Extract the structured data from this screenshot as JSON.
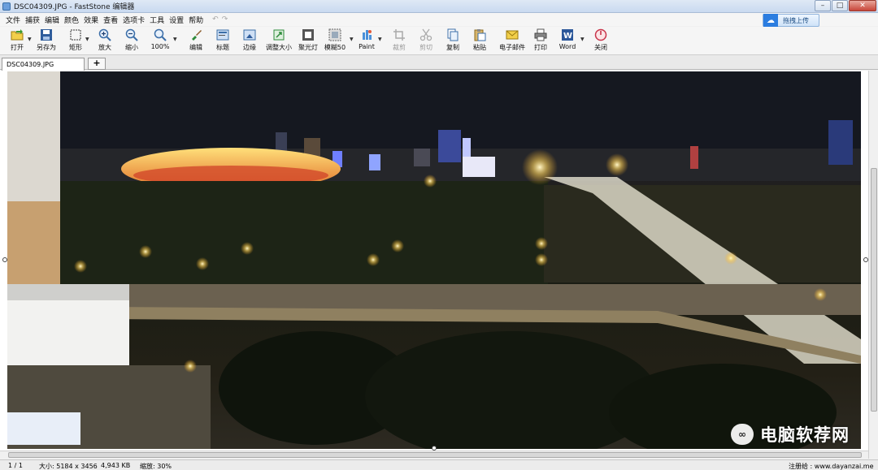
{
  "window": {
    "title": "DSC04309.JPG - FastStone 编辑器",
    "minimize": "–",
    "maximize": "□",
    "close": "✕"
  },
  "menu": [
    "文件",
    "捕获",
    "编辑",
    "颜色",
    "效果",
    "查看",
    "选项卡",
    "工具",
    "设置",
    "帮助"
  ],
  "menu_undo": "↶",
  "menu_redo": "↷",
  "upload": {
    "label": "拖拽上传",
    "icon": "cloud-icon"
  },
  "toolbar": {
    "open": {
      "label": "打开",
      "icon": "open-folder-icon",
      "color": "#3c9a2a"
    },
    "save_as": {
      "label": "另存为",
      "icon": "floppy-disk-icon",
      "color": "#2f5d9c"
    },
    "rect": {
      "label": "矩形",
      "icon": "rectangle-select-icon"
    },
    "zoom_in": {
      "label": "放大",
      "icon": "zoom-in-icon"
    },
    "zoom_out": {
      "label": "缩小",
      "icon": "zoom-out-icon"
    },
    "zoom_100": {
      "label": "100%",
      "icon": "magnifier-icon"
    },
    "edit": {
      "label": "编辑",
      "icon": "paint-brush-icon"
    },
    "caption": {
      "label": "标题",
      "icon": "caption-icon"
    },
    "edge": {
      "label": "边缘",
      "icon": "border-icon"
    },
    "resize": {
      "label": "调整大小",
      "icon": "resize-icon"
    },
    "spotlight": {
      "label": "聚光灯",
      "icon": "spotlight-icon"
    },
    "blur": {
      "label": "模糊50",
      "icon": "blur-icon"
    },
    "paint": {
      "label": "Paint",
      "icon": "paint-palette-icon"
    },
    "crop": {
      "label": "裁剪",
      "icon": "crop-icon"
    },
    "cut": {
      "label": "剪切",
      "icon": "scissors-icon"
    },
    "copy": {
      "label": "复制",
      "icon": "copy-icon"
    },
    "paste": {
      "label": "粘贴",
      "icon": "paste-icon"
    },
    "email": {
      "label": "电子邮件",
      "icon": "envelope-icon"
    },
    "print": {
      "label": "打印",
      "icon": "printer-icon"
    },
    "word": {
      "label": "Word",
      "icon": "word-icon"
    },
    "close": {
      "label": "关闭",
      "icon": "power-icon"
    }
  },
  "tabs": {
    "file": "DSC04309.JPG",
    "add": "+"
  },
  "watermark": {
    "icon": "wechat-icon",
    "text": "电脑软荐网"
  },
  "status": {
    "page": "1 / 1",
    "size": "大小: 5184 x 3456",
    "filesize": "4,943 KB",
    "zoom": "缩放: 30%",
    "register": "注册给 : www.dayanzai.me"
  }
}
